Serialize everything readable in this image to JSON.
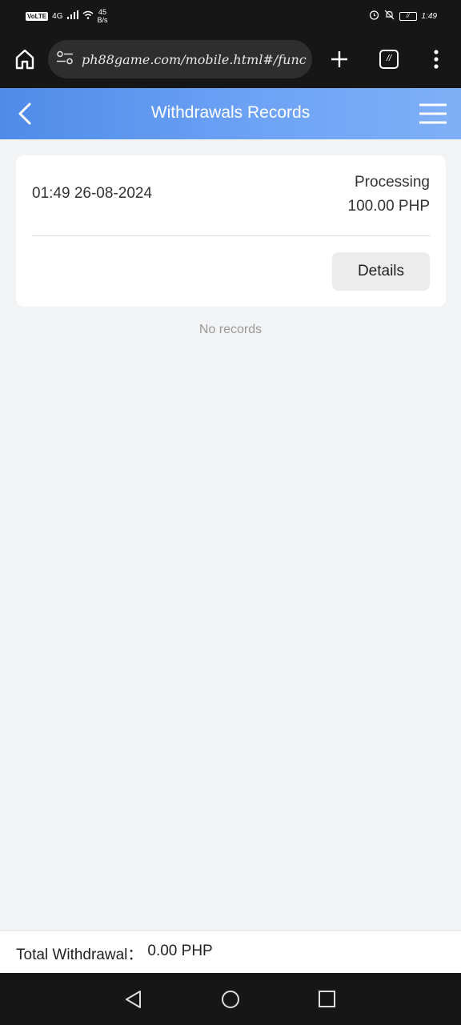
{
  "status_bar": {
    "volte": "VoLTE",
    "network": "4G",
    "speed_value": "45",
    "speed_unit": "B/s",
    "battery": "//",
    "time": "1:49"
  },
  "browser": {
    "url": "ph88game.com/mobile.html#/func",
    "tab_count": "//"
  },
  "header": {
    "title": "Withdrawals Records"
  },
  "record": {
    "time": "01:49 26-08-2024",
    "status": "Processing",
    "amount": "100.00 PHP",
    "details_label": "Details"
  },
  "empty_message": "No records",
  "footer": {
    "total_label": "Total Withdrawal：",
    "total_value": "0.00 PHP"
  },
  "colors": {
    "header_gradient_start": "#4f8be8",
    "header_gradient_end": "#7fb0f7",
    "page_background": "#f2f3f5",
    "system_bar": "#161616"
  }
}
